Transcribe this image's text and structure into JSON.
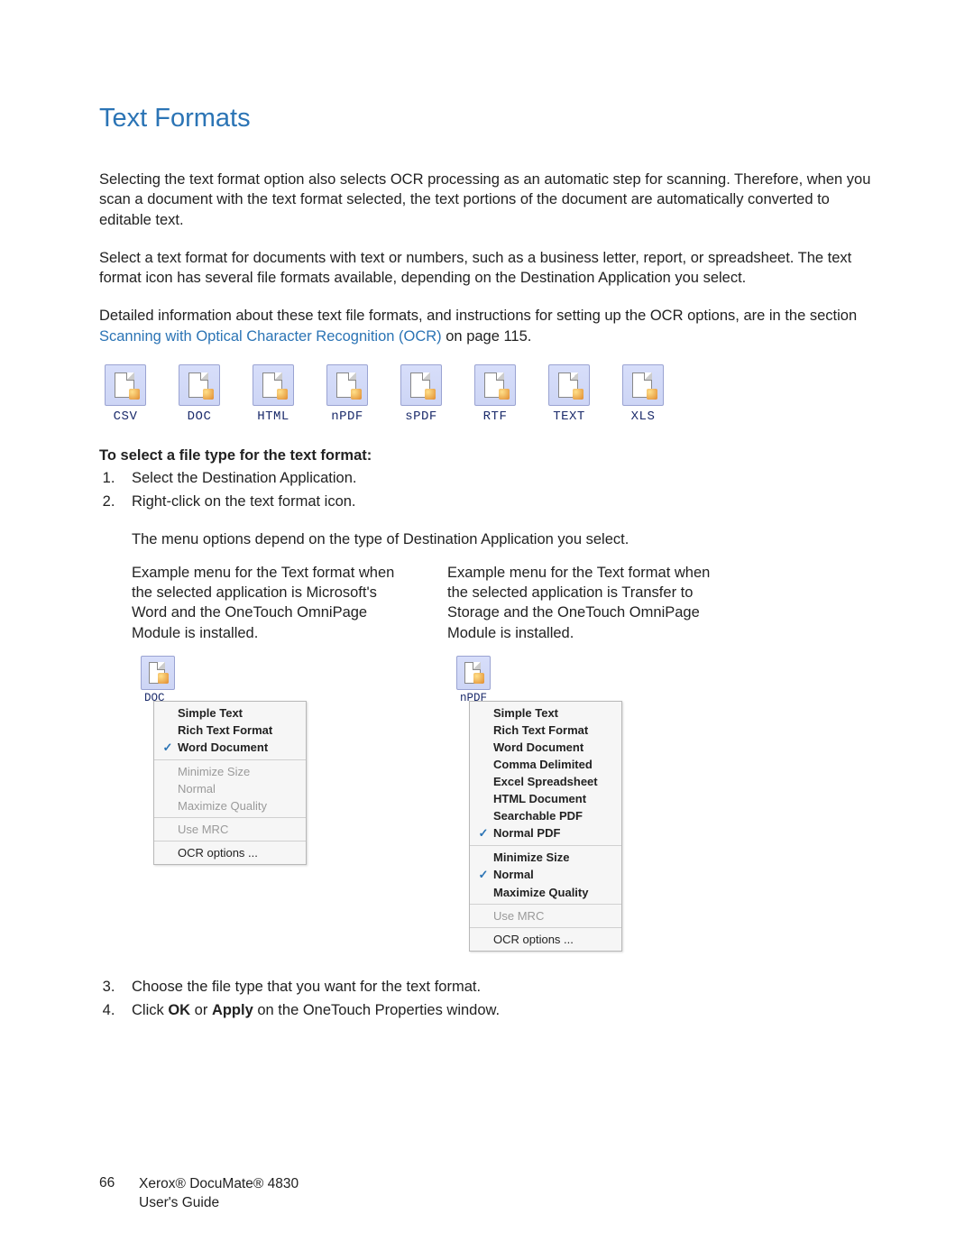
{
  "title": "Text Formats",
  "para1": "Selecting the text format option also selects OCR processing as an automatic step for scanning. Therefore, when you scan a document with the text format selected, the text portions of the document are automatically converted to editable text.",
  "para2": "Select a text format for documents with text or numbers, such as a business letter, report, or spreadsheet. The text format icon has several file formats available, depending on the Destination Application you select.",
  "para3_prefix": "Detailed information about these text file formats, and instructions for setting up the OCR options, are in the section ",
  "para3_link": "Scanning with Optical Character Recognition (OCR)",
  "para3_suffix": " on page 115.",
  "formats": [
    "CSV",
    "DOC",
    "HTML",
    "nPDF",
    "sPDF",
    "RTF",
    "TEXT",
    "XLS"
  ],
  "instr_heading": "To select a file type for the text format:",
  "steps12": [
    "Select the Destination Application.",
    "Right-click on the text format icon."
  ],
  "step2_note": "The menu options depend on the type of Destination Application you select.",
  "left_caption": "Example menu for the Text format when the selected application is Microsoft's Word and the OneTouch OmniPage Module is installed.",
  "right_caption": "Example menu for the Text format when the selected application is Transfer to Storage and the OneTouch OmniPage Module is installed.",
  "left_icon_label": "DOC",
  "right_icon_label": "nPDF",
  "left_menu": {
    "groups": [
      [
        {
          "label": "Simple Text",
          "bold": true,
          "checked": false,
          "disabled": false
        },
        {
          "label": "Rich Text Format",
          "bold": true,
          "checked": false,
          "disabled": false
        },
        {
          "label": "Word Document",
          "bold": true,
          "checked": true,
          "disabled": false
        }
      ],
      [
        {
          "label": "Minimize Size",
          "bold": false,
          "checked": false,
          "disabled": true
        },
        {
          "label": "Normal",
          "bold": false,
          "checked": false,
          "disabled": true
        },
        {
          "label": "Maximize Quality",
          "bold": false,
          "checked": false,
          "disabled": true
        }
      ],
      [
        {
          "label": "Use MRC",
          "bold": false,
          "checked": false,
          "disabled": true
        }
      ],
      [
        {
          "label": "OCR options ...",
          "bold": false,
          "checked": false,
          "disabled": false
        }
      ]
    ]
  },
  "right_menu": {
    "groups": [
      [
        {
          "label": "Simple Text",
          "bold": true,
          "checked": false,
          "disabled": false
        },
        {
          "label": "Rich Text Format",
          "bold": true,
          "checked": false,
          "disabled": false
        },
        {
          "label": "Word Document",
          "bold": true,
          "checked": false,
          "disabled": false
        },
        {
          "label": "Comma Delimited",
          "bold": true,
          "checked": false,
          "disabled": false
        },
        {
          "label": "Excel Spreadsheet",
          "bold": true,
          "checked": false,
          "disabled": false
        },
        {
          "label": "HTML Document",
          "bold": true,
          "checked": false,
          "disabled": false
        },
        {
          "label": "Searchable PDF",
          "bold": true,
          "checked": false,
          "disabled": false
        },
        {
          "label": "Normal PDF",
          "bold": true,
          "checked": true,
          "disabled": false
        }
      ],
      [
        {
          "label": "Minimize Size",
          "bold": true,
          "checked": false,
          "disabled": false
        },
        {
          "label": "Normal",
          "bold": true,
          "checked": true,
          "disabled": false
        },
        {
          "label": "Maximize Quality",
          "bold": true,
          "checked": false,
          "disabled": false
        }
      ],
      [
        {
          "label": "Use MRC",
          "bold": false,
          "checked": false,
          "disabled": true
        }
      ],
      [
        {
          "label": "OCR options ...",
          "bold": false,
          "checked": false,
          "disabled": false
        }
      ]
    ]
  },
  "steps34": [
    "Choose the file type that you want for the text format.",
    "Click OK or Apply on the OneTouch Properties window."
  ],
  "steper n": "",
  "footer": {
    "page_num": "66",
    "line1": "Xerox® DocuMate® 4830",
    "line2": "User's Guide"
  }
}
